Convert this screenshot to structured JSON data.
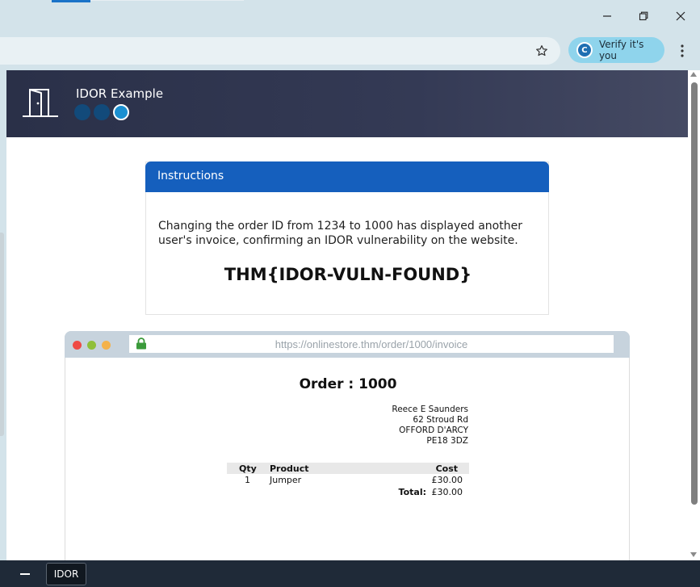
{
  "browser": {
    "verify_label": "Verify it's you",
    "verify_avatar_letter": "C"
  },
  "site": {
    "title": "IDOR Example",
    "steps_total": 3,
    "current_step": 3
  },
  "instructions": {
    "heading": "Instructions",
    "body": "Changing the order ID from 1234 to 1000 has displayed another user's invoice, confirming an IDOR vulnerability on the website.",
    "flag": "THM{IDOR-VULN-FOUND}"
  },
  "mock_browser": {
    "url": "https://onlinestore.thm/order/1000/invoice"
  },
  "invoice": {
    "title": "Order : 1000",
    "address": {
      "name": "Reece E Saunders",
      "line1": "62 Stroud Rd",
      "city": "OFFORD D'ARCY",
      "postcode": "PE18 3DZ"
    },
    "columns": {
      "qty": "Qty",
      "product": "Product",
      "cost": "Cost"
    },
    "rows": [
      {
        "qty": "1",
        "product": "Jumper",
        "cost": "£30.00"
      }
    ],
    "total_label": "Total:",
    "total_value": "£30.00"
  },
  "taskbar": {
    "tab_label": "IDOR"
  },
  "colors": {
    "header_bg": "#2a3048",
    "accent_blue": "#155fbd",
    "verify_chip": "#8fd4ec"
  }
}
